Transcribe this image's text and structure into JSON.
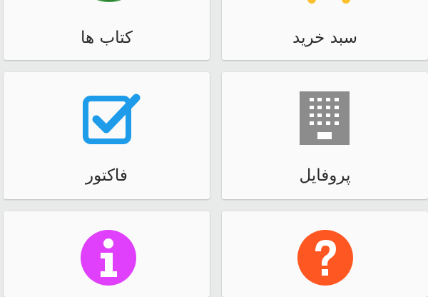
{
  "menu": {
    "books": {
      "label": "کتاب ها",
      "icon": "books-icon",
      "color": "#43a047"
    },
    "cart": {
      "label": "سبد خرید",
      "icon": "cart-icon",
      "color": "#fbc02d"
    },
    "invoice": {
      "label": "فاکتور",
      "icon": "checkbox-checked-icon",
      "color": "#1e9be9"
    },
    "profile": {
      "label": "پروفایل",
      "icon": "building-icon",
      "color": "#8c8c8c"
    },
    "info": {
      "label": "",
      "icon": "info-icon",
      "color": "#e040fb"
    },
    "help": {
      "label": "",
      "icon": "help-icon",
      "color": "#ff5722"
    }
  }
}
